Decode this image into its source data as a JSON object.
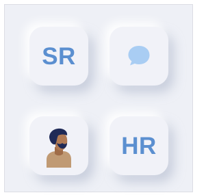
{
  "tiles": [
    {
      "kind": "text",
      "label": "SR"
    },
    {
      "kind": "icon",
      "icon": "chat-bubble-icon"
    },
    {
      "kind": "icon",
      "icon": "person-avatar-icon"
    },
    {
      "kind": "text",
      "label": "HR"
    }
  ],
  "colors": {
    "background": "#eef0f6",
    "tile": "#f1f2f8",
    "accent": "#5b8fd0",
    "chat_bubble": "#a9cdf3",
    "skin": "#b07a55",
    "hair": "#1f2a57",
    "shirt": "#c09a74"
  }
}
